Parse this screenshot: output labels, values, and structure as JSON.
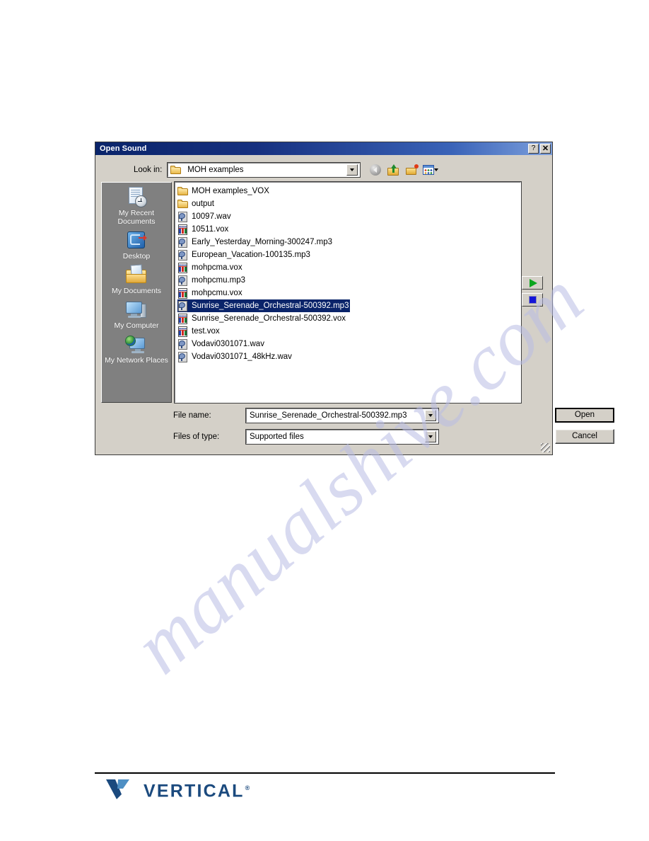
{
  "dialog": {
    "title": "Open Sound",
    "titlebar_buttons": [
      {
        "name": "help-button",
        "label": "?"
      },
      {
        "name": "close-button",
        "label": "✕"
      }
    ],
    "lookin": {
      "label": "Look in:",
      "value": "MOH examples"
    },
    "toolbar": [
      {
        "name": "back-icon",
        "tooltip": "Back"
      },
      {
        "name": "up-one-level-icon",
        "tooltip": "Up One Level"
      },
      {
        "name": "new-folder-icon",
        "tooltip": "Create New Folder"
      },
      {
        "name": "views-icon",
        "tooltip": "Views"
      }
    ],
    "places": [
      {
        "label": "My Recent Documents",
        "icon": "recent-documents-icon"
      },
      {
        "label": "Desktop",
        "icon": "desktop-icon"
      },
      {
        "label": "My Documents",
        "icon": "my-documents-icon"
      },
      {
        "label": "My Computer",
        "icon": "my-computer-icon"
      },
      {
        "label": "My Network Places",
        "icon": "my-network-places-icon"
      }
    ],
    "files": [
      {
        "name": "MOH examples_VOX",
        "type": "folder",
        "selected": false
      },
      {
        "name": "output",
        "type": "folder",
        "selected": false
      },
      {
        "name": "10097.wav",
        "type": "media",
        "selected": false
      },
      {
        "name": "10511.vox",
        "type": "vox",
        "selected": false
      },
      {
        "name": "Early_Yesterday_Morning-300247.mp3",
        "type": "media",
        "selected": false
      },
      {
        "name": "European_Vacation-100135.mp3",
        "type": "media",
        "selected": false
      },
      {
        "name": "mohpcma.vox",
        "type": "vox",
        "selected": false
      },
      {
        "name": "mohpcmu.mp3",
        "type": "media",
        "selected": false
      },
      {
        "name": "mohpcmu.vox",
        "type": "vox",
        "selected": false
      },
      {
        "name": "Sunrise_Serenade_Orchestral-500392.mp3",
        "type": "media",
        "selected": true
      },
      {
        "name": "Sunrise_Serenade_Orchestral-500392.vox",
        "type": "vox",
        "selected": false
      },
      {
        "name": "test.vox",
        "type": "vox",
        "selected": false
      },
      {
        "name": "Vodavi0301071.wav",
        "type": "media",
        "selected": false
      },
      {
        "name": "Vodavi0301071_48kHz.wav",
        "type": "media",
        "selected": false
      }
    ],
    "filename": {
      "label": "File name:",
      "value": "Sunrise_Serenade_Orchestral-500392.mp3"
    },
    "filetype": {
      "label": "Files of type:",
      "value": "Supported files"
    },
    "buttons": {
      "open": "Open",
      "cancel": "Cancel"
    },
    "media_controls": [
      {
        "name": "play-button",
        "icon": "play-icon"
      },
      {
        "name": "stop-button",
        "icon": "stop-icon"
      }
    ]
  },
  "footer": {
    "brand": "VERTICAL",
    "trademark": "®"
  },
  "watermark": {
    "text": "manualshive.com"
  },
  "colors": {
    "titlebar_start": "#0a246a",
    "titlebar_end": "#7da0dd",
    "dialog_face": "#d4d0c8",
    "selection": "#0a246a",
    "places_bg": "#808080",
    "play_green": "#0aa51e",
    "stop_blue": "#1414d8",
    "brand_navy": "#1b4a7e",
    "watermark": "#b9bde4"
  }
}
